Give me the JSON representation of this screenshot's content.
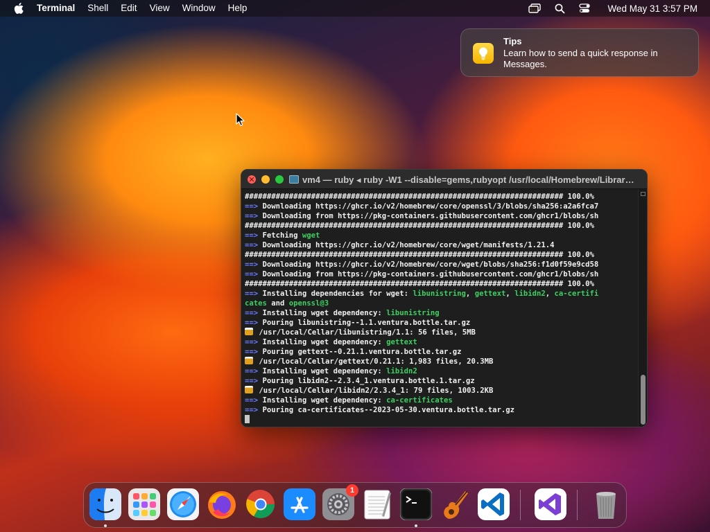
{
  "menubar": {
    "app_name": "Terminal",
    "items": [
      "Shell",
      "Edit",
      "View",
      "Window",
      "Help"
    ],
    "clock": "Wed May 31  3:57 PM"
  },
  "notification": {
    "app": "Tips",
    "title": "Tips",
    "body": "Learn how to send a quick response in Messages."
  },
  "terminal": {
    "title": "vm4 — ruby ◂ ruby -W1 --disable=gems,rubyopt /usr/local/Homebrew/Librar…",
    "lines": [
      [
        {
          "t": "######################################################################## 100.0%"
        }
      ],
      [
        {
          "t": "==>",
          "c": "arrow"
        },
        {
          "t": " Downloading https://ghcr.io/v2/homebrew/core/openssl/3/blobs/sha256:a2a6fca7"
        }
      ],
      [
        {
          "t": "==>",
          "c": "arrow"
        },
        {
          "t": " Downloading from https://pkg-containers.githubusercontent.com/ghcr1/blobs/sh"
        }
      ],
      [
        {
          "t": "######################################################################## 100.0%"
        }
      ],
      [
        {
          "t": "==>",
          "c": "arrow"
        },
        {
          "t": " Fetching "
        },
        {
          "t": "wget",
          "c": "green"
        }
      ],
      [
        {
          "t": "==>",
          "c": "arrow"
        },
        {
          "t": " Downloading https://ghcr.io/v2/homebrew/core/wget/manifests/1.21.4"
        }
      ],
      [
        {
          "t": "######################################################################## 100.0%"
        }
      ],
      [
        {
          "t": "==>",
          "c": "arrow"
        },
        {
          "t": " Downloading https://ghcr.io/v2/homebrew/core/wget/blobs/sha256:f1d0f59e9cd58"
        }
      ],
      [
        {
          "t": "==>",
          "c": "arrow"
        },
        {
          "t": " Downloading from https://pkg-containers.githubusercontent.com/ghcr1/blobs/sh"
        }
      ],
      [
        {
          "t": "######################################################################## 100.0%"
        }
      ],
      [
        {
          "t": "==>",
          "c": "arrow"
        },
        {
          "t": " Installing dependencies for wget: "
        },
        {
          "t": "libunistring",
          "c": "green"
        },
        {
          "t": ", "
        },
        {
          "t": "gettext",
          "c": "green"
        },
        {
          "t": ", "
        },
        {
          "t": "libidn2",
          "c": "green"
        },
        {
          "t": ", "
        },
        {
          "t": "ca-certifi",
          "c": "green"
        }
      ],
      [
        {
          "t": "cates",
          "c": "green"
        },
        {
          "t": " and "
        },
        {
          "t": "openssl@3",
          "c": "green"
        }
      ],
      [
        {
          "t": "==>",
          "c": "arrow"
        },
        {
          "t": " Installing wget dependency: "
        },
        {
          "t": "libunistring",
          "c": "green"
        }
      ],
      [
        {
          "t": "==>",
          "c": "arrow"
        },
        {
          "t": " Pouring libunistring--1.1.ventura.bottle.tar.gz"
        }
      ],
      [
        {
          "t": "🍺",
          "c": "beer"
        },
        {
          "t": " /usr/local/Cellar/libunistring/1.1: 56 files, 5MB"
        }
      ],
      [
        {
          "t": "==>",
          "c": "arrow"
        },
        {
          "t": " Installing wget dependency: "
        },
        {
          "t": "gettext",
          "c": "green"
        }
      ],
      [
        {
          "t": "==>",
          "c": "arrow"
        },
        {
          "t": " Pouring gettext--0.21.1.ventura.bottle.tar.gz"
        }
      ],
      [
        {
          "t": "🍺",
          "c": "beer"
        },
        {
          "t": " /usr/local/Cellar/gettext/0.21.1: 1,983 files, 20.3MB"
        }
      ],
      [
        {
          "t": "==>",
          "c": "arrow"
        },
        {
          "t": " Installing wget dependency: "
        },
        {
          "t": "libidn2",
          "c": "green"
        }
      ],
      [
        {
          "t": "==>",
          "c": "arrow"
        },
        {
          "t": " Pouring libidn2--2.3.4_1.ventura.bottle.1.tar.gz"
        }
      ],
      [
        {
          "t": "🍺",
          "c": "beer"
        },
        {
          "t": " /usr/local/Cellar/libidn2/2.3.4_1: 79 files, 1003.2KB"
        }
      ],
      [
        {
          "t": "==>",
          "c": "arrow"
        },
        {
          "t": " Installing wget dependency: "
        },
        {
          "t": "ca-certificates",
          "c": "green"
        }
      ],
      [
        {
          "t": "==>",
          "c": "arrow"
        },
        {
          "t": " Pouring ca-certificates--2023-05-30.ventura.bottle.tar.gz"
        }
      ]
    ]
  },
  "dock": {
    "apps": [
      {
        "name": "Finder",
        "icon": "finder-icon",
        "running": true
      },
      {
        "name": "Launchpad",
        "icon": "launchpad-icon",
        "running": false
      },
      {
        "name": "Safari",
        "icon": "safari-icon",
        "running": false
      },
      {
        "name": "Firefox",
        "icon": "firefox-icon",
        "running": false
      },
      {
        "name": "Google Chrome",
        "icon": "chrome-icon",
        "running": false
      },
      {
        "name": "App Store",
        "icon": "app-store-icon",
        "running": false
      },
      {
        "name": "System Settings",
        "icon": "system-settings-icon",
        "running": false,
        "badge": "1"
      },
      {
        "name": "TextEdit",
        "icon": "textedit-icon",
        "running": false
      },
      {
        "name": "Terminal",
        "icon": "terminal-icon",
        "running": true
      },
      {
        "name": "GarageBand",
        "icon": "garageband-icon",
        "running": false
      },
      {
        "name": "Visual Studio Code",
        "icon": "vscode-icon",
        "running": false
      },
      {
        "name": "Visual Studio",
        "icon": "visual-studio-icon",
        "running": false
      },
      {
        "name": "Trash",
        "icon": "trash-icon",
        "running": false
      }
    ]
  },
  "colors": {
    "arrow": "#6b7cff",
    "green": "#3cd160",
    "terminal_bg": "#1e1e1e"
  }
}
